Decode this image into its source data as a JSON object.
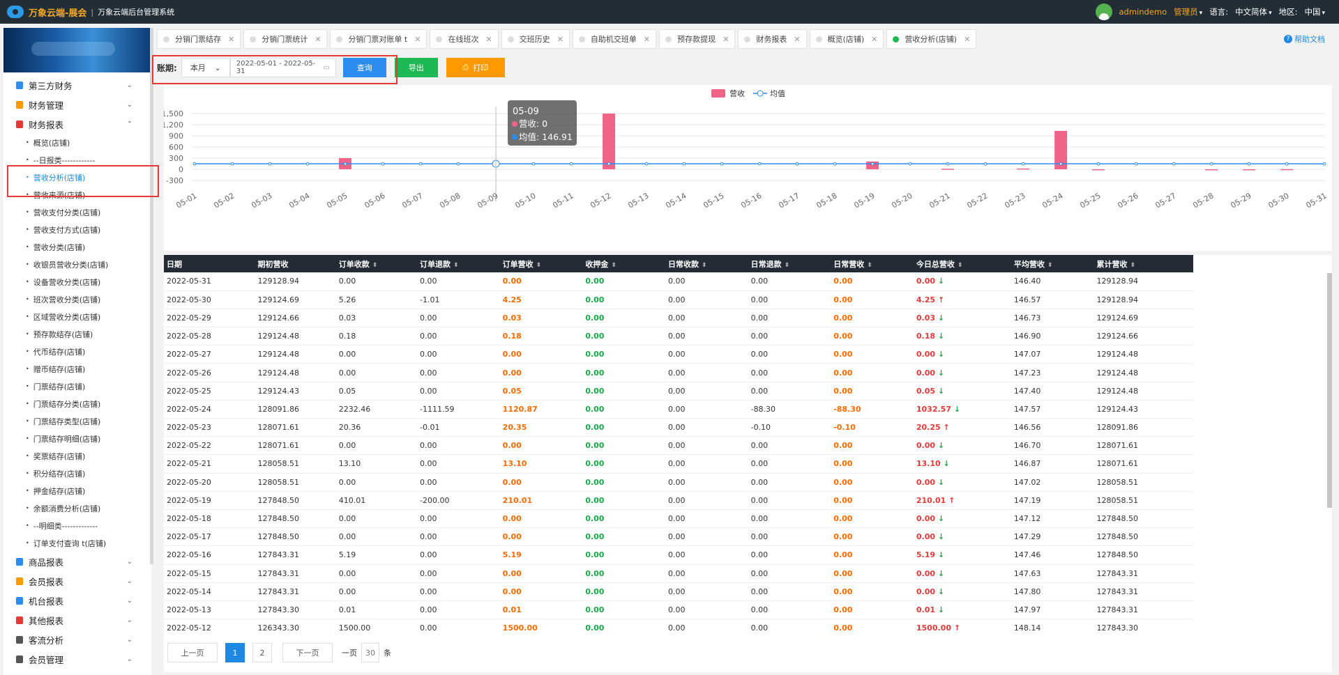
{
  "top": {
    "brand": "万象云端-展会",
    "sep": "|",
    "system": "万象云端后台管理系统",
    "username": "admindemo",
    "role": "管理员",
    "lang_label": "语言:",
    "lang": "中文简体",
    "region_label": "地区:",
    "region": "中国"
  },
  "sidebar": {
    "groups_top": [
      {
        "label": "第三方财务",
        "color": "#2d8cf0"
      },
      {
        "label": "财务管理",
        "color": "#ff9900"
      },
      {
        "label": "财务报表",
        "color": "#e53935"
      }
    ],
    "items": [
      "概览(店铺)",
      "--日报类------------",
      "营收分析(店铺)",
      "营收来源(店铺)",
      "营收支付分类(店铺)",
      "营收支付方式(店铺)",
      "营收分类(店铺)",
      "收银员营收分类(店铺)",
      "设备营收分类(店铺)",
      "班次营收分类(店铺)",
      "区域营收分类(店铺)",
      "预存款结存(店铺)",
      "代币结存(店铺)",
      "赠币结存(店铺)",
      "门票结存(店铺)",
      "门票结存分类(店铺)",
      "门票结存类型(店铺)",
      "门票结存明细(店铺)",
      "奖票结存(店铺)",
      "积分结存(店铺)",
      "押金结存(店铺)",
      "余额消费分析(店铺)",
      "--明细类-------------",
      "订单支付查询 t(店铺)"
    ],
    "groups_bottom": [
      {
        "label": "商品报表",
        "color": "#2d8cf0"
      },
      {
        "label": "会员报表",
        "color": "#ff9900"
      },
      {
        "label": "机台报表",
        "color": "#2d8cf0"
      },
      {
        "label": "其他报表",
        "color": "#e53935"
      },
      {
        "label": "客流分析",
        "color": "#555"
      },
      {
        "label": "会员管理",
        "color": "#555"
      }
    ]
  },
  "tabs": [
    "分销门票结存",
    "分销门票统计",
    "分销门票对账单 t",
    "在线班次",
    "交班历史",
    "自助机交班单",
    "预存款提现",
    "财务报表",
    "概览(店铺)",
    "营收分析(店铺)"
  ],
  "help": "帮助文档",
  "toolbar": {
    "label": "账期:",
    "period": "本月",
    "daterange": "2022-05-01 - 2022-05-31",
    "query": "查询",
    "export": "导出",
    "print": "打印"
  },
  "annotations": {
    "one": "1",
    "two": "2"
  },
  "chart_data": {
    "type": "bar",
    "legend": [
      "营收",
      "均值"
    ],
    "categories": [
      "05-01",
      "05-02",
      "05-03",
      "05-04",
      "05-05",
      "05-06",
      "05-07",
      "05-08",
      "05-09",
      "05-10",
      "05-11",
      "05-12",
      "05-13",
      "05-14",
      "05-15",
      "05-16",
      "05-17",
      "05-18",
      "05-19",
      "05-20",
      "05-21",
      "05-22",
      "05-23",
      "05-24",
      "05-25",
      "05-26",
      "05-27",
      "05-28",
      "05-29",
      "05-30",
      "05-31"
    ],
    "series": [
      {
        "name": "营收",
        "type": "bar",
        "color": "#f0648a",
        "values": [
          0,
          0,
          0,
          0,
          300,
          0,
          0,
          0,
          0,
          0,
          0,
          1500,
          0,
          0,
          0,
          0,
          0,
          0,
          210.01,
          0,
          13.1,
          0,
          20.25,
          1032.57,
          0.05,
          0,
          0,
          0.18,
          0.03,
          4.25,
          0
        ]
      },
      {
        "name": "均值",
        "type": "line",
        "color": "#2d8cf0",
        "values": [
          146.91,
          146.91,
          146.91,
          146.91,
          146.91,
          146.91,
          146.91,
          146.91,
          146.91,
          146.91,
          146.91,
          148.14,
          147.97,
          147.8,
          147.63,
          147.46,
          147.29,
          147.12,
          147.19,
          147.02,
          146.87,
          146.7,
          146.56,
          147.57,
          147.4,
          147.23,
          147.07,
          146.9,
          146.73,
          146.57,
          146.4
        ]
      }
    ],
    "y_ticks": [
      "1,500",
      "1,200",
      "900",
      "600",
      "300",
      "0",
      "-300"
    ],
    "ylim": [
      -300,
      1500
    ],
    "tooltip": {
      "title": "05-09",
      "rev": "营收: 0",
      "avg": "均值: 146.91"
    }
  },
  "table": {
    "headers": [
      "日期",
      "期初营收",
      "订单收款",
      "订单退款",
      "订单营收",
      "收押金",
      "日常收款",
      "日常退款",
      "日常营收",
      "今日总营收",
      "平均营收",
      "累计营收"
    ],
    "sortable": [
      false,
      false,
      true,
      true,
      true,
      true,
      true,
      true,
      true,
      true,
      true,
      true
    ],
    "rows": [
      [
        "2022-05-31",
        "129128.94",
        "0.00",
        "0.00",
        "0.00",
        "0.00",
        "0.00",
        "0.00",
        "0.00",
        "0.00",
        "down",
        "146.40",
        "129128.94"
      ],
      [
        "2022-05-30",
        "129124.69",
        "5.26",
        "-1.01",
        "4.25",
        "0.00",
        "0.00",
        "0.00",
        "0.00",
        "4.25",
        "up",
        "146.57",
        "129128.94"
      ],
      [
        "2022-05-29",
        "129124.66",
        "0.03",
        "0.00",
        "0.03",
        "0.00",
        "0.00",
        "0.00",
        "0.00",
        "0.03",
        "down",
        "146.73",
        "129124.69"
      ],
      [
        "2022-05-28",
        "129124.48",
        "0.18",
        "0.00",
        "0.18",
        "0.00",
        "0.00",
        "0.00",
        "0.00",
        "0.18",
        "down",
        "146.90",
        "129124.66"
      ],
      [
        "2022-05-27",
        "129124.48",
        "0.00",
        "0.00",
        "0.00",
        "0.00",
        "0.00",
        "0.00",
        "0.00",
        "0.00",
        "down",
        "147.07",
        "129124.48"
      ],
      [
        "2022-05-26",
        "129124.48",
        "0.00",
        "0.00",
        "0.00",
        "0.00",
        "0.00",
        "0.00",
        "0.00",
        "0.00",
        "down",
        "147.23",
        "129124.48"
      ],
      [
        "2022-05-25",
        "129124.43",
        "0.05",
        "0.00",
        "0.05",
        "0.00",
        "0.00",
        "0.00",
        "0.00",
        "0.05",
        "down",
        "147.40",
        "129124.48"
      ],
      [
        "2022-05-24",
        "128091.86",
        "2232.46",
        "-1111.59",
        "1120.87",
        "0.00",
        "0.00",
        "-88.30",
        "-88.30",
        "1032.57",
        "down",
        "147.57",
        "129124.43"
      ],
      [
        "2022-05-23",
        "128071.61",
        "20.36",
        "-0.01",
        "20.35",
        "0.00",
        "0.00",
        "-0.10",
        "-0.10",
        "20.25",
        "up",
        "146.56",
        "128091.86"
      ],
      [
        "2022-05-22",
        "128071.61",
        "0.00",
        "0.00",
        "0.00",
        "0.00",
        "0.00",
        "0.00",
        "0.00",
        "0.00",
        "down",
        "146.70",
        "128071.61"
      ],
      [
        "2022-05-21",
        "128058.51",
        "13.10",
        "0.00",
        "13.10",
        "0.00",
        "0.00",
        "0.00",
        "0.00",
        "13.10",
        "down",
        "146.87",
        "128071.61"
      ],
      [
        "2022-05-20",
        "128058.51",
        "0.00",
        "0.00",
        "0.00",
        "0.00",
        "0.00",
        "0.00",
        "0.00",
        "0.00",
        "down",
        "147.02",
        "128058.51"
      ],
      [
        "2022-05-19",
        "127848.50",
        "410.01",
        "-200.00",
        "210.01",
        "0.00",
        "0.00",
        "0.00",
        "0.00",
        "210.01",
        "up",
        "147.19",
        "128058.51"
      ],
      [
        "2022-05-18",
        "127848.50",
        "0.00",
        "0.00",
        "0.00",
        "0.00",
        "0.00",
        "0.00",
        "0.00",
        "0.00",
        "down",
        "147.12",
        "127848.50"
      ],
      [
        "2022-05-17",
        "127848.50",
        "0.00",
        "0.00",
        "0.00",
        "0.00",
        "0.00",
        "0.00",
        "0.00",
        "0.00",
        "down",
        "147.29",
        "127848.50"
      ],
      [
        "2022-05-16",
        "127843.31",
        "5.19",
        "0.00",
        "5.19",
        "0.00",
        "0.00",
        "0.00",
        "0.00",
        "5.19",
        "down",
        "147.46",
        "127848.50"
      ],
      [
        "2022-05-15",
        "127843.31",
        "0.00",
        "0.00",
        "0.00",
        "0.00",
        "0.00",
        "0.00",
        "0.00",
        "0.00",
        "down",
        "147.63",
        "127843.31"
      ],
      [
        "2022-05-14",
        "127843.31",
        "0.00",
        "0.00",
        "0.00",
        "0.00",
        "0.00",
        "0.00",
        "0.00",
        "0.00",
        "down",
        "147.80",
        "127843.31"
      ],
      [
        "2022-05-13",
        "127843.30",
        "0.01",
        "0.00",
        "0.01",
        "0.00",
        "0.00",
        "0.00",
        "0.00",
        "0.01",
        "down",
        "147.97",
        "127843.31"
      ],
      [
        "2022-05-12",
        "126343.30",
        "1500.00",
        "0.00",
        "1500.00",
        "0.00",
        "0.00",
        "0.00",
        "0.00",
        "1500.00",
        "up",
        "148.14",
        "127843.30"
      ]
    ]
  },
  "pager": {
    "prev": "上一页",
    "pages": [
      "1",
      "2"
    ],
    "current": "1",
    "next": "下一页",
    "per_label": "一页",
    "per_size": "30",
    "per_unit": "条"
  }
}
